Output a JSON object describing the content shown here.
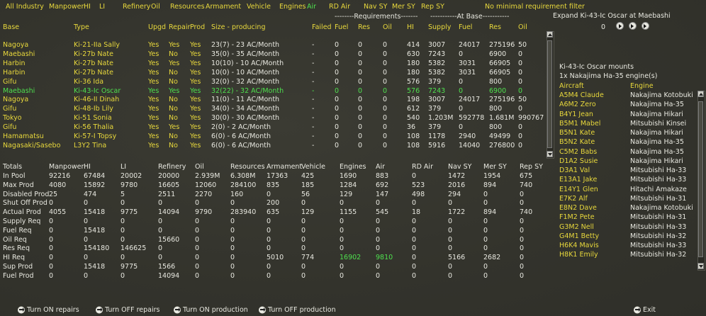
{
  "filters": [
    {
      "label": "All Industry",
      "active": false
    },
    {
      "label": "Manpower",
      "active": false
    },
    {
      "label": "HI",
      "active": false
    },
    {
      "label": "LI",
      "active": false
    },
    {
      "label": "Refinery",
      "active": false
    },
    {
      "label": "Oil",
      "active": false
    },
    {
      "label": "Resources",
      "active": false
    },
    {
      "label": "Armament",
      "active": false
    },
    {
      "label": "Vehicle",
      "active": false
    },
    {
      "label": "Engines",
      "active": false
    },
    {
      "label": "Air",
      "active": true
    },
    {
      "label": "RD Air",
      "active": false
    },
    {
      "label": "Nav SY",
      "active": false
    },
    {
      "label": "Mer SY",
      "active": false
    },
    {
      "label": "Rep SY",
      "active": false
    },
    {
      "label": "No minimal requirement filter",
      "active": false
    }
  ],
  "group_headers": {
    "requirements": "--------Requirements-------",
    "atbase": "-----------At Base-----------"
  },
  "columns": [
    "Base",
    "Type",
    "Upgd",
    "Repair",
    "Prod",
    "Size - producing",
    "Failed",
    "Fuel",
    "Res",
    "Oil",
    "HI",
    "Supply",
    "Fuel",
    "Res",
    "Oil"
  ],
  "factories": [
    {
      "base": "Nagoya",
      "type": "Ki-21-IIa Sally",
      "upgd": "Yes",
      "repair": "Yes",
      "prod": "Yes",
      "size": "23(7) - 23 AC/Month",
      "failed": "-",
      "fuel": "0",
      "res": "0",
      "oil": "0",
      "hi": "414",
      "supply": "3007",
      "bfuel": "24017",
      "bres": "275196",
      "boil": "50",
      "sel": false
    },
    {
      "base": "Maebashi",
      "type": "Ki-27b Nate",
      "upgd": "Yes",
      "repair": "No",
      "prod": "Yes",
      "size": "35(0) - 35 AC/Month",
      "failed": "-",
      "fuel": "0",
      "res": "0",
      "oil": "0",
      "hi": "630",
      "supply": "7243",
      "bfuel": "0",
      "bres": "6900",
      "boil": "0",
      "sel": false
    },
    {
      "base": "Harbin",
      "type": "Ki-27b Nate",
      "upgd": "Yes",
      "repair": "Yes",
      "prod": "Yes",
      "size": "10(10) - 10 AC/Month",
      "failed": "-",
      "fuel": "0",
      "res": "0",
      "oil": "0",
      "hi": "180",
      "supply": "5382",
      "bfuel": "3031",
      "bres": "66905",
      "boil": "0",
      "sel": false
    },
    {
      "base": "Harbin",
      "type": "Ki-27b Nate",
      "upgd": "Yes",
      "repair": "No",
      "prod": "Yes",
      "size": "10(0) - 10 AC/Month",
      "failed": "-",
      "fuel": "0",
      "res": "0",
      "oil": "0",
      "hi": "180",
      "supply": "5382",
      "bfuel": "3031",
      "bres": "66905",
      "boil": "0",
      "sel": false
    },
    {
      "base": "Gifu",
      "type": "Ki-36 Ida",
      "upgd": "Yes",
      "repair": "No",
      "prod": "Yes",
      "size": "32(0) - 32 AC/Month",
      "failed": "-",
      "fuel": "0",
      "res": "0",
      "oil": "0",
      "hi": "576",
      "supply": "379",
      "bfuel": "0",
      "bres": "800",
      "boil": "0",
      "sel": false
    },
    {
      "base": "Maebashi",
      "type": "Ki-43-Ic Oscar",
      "upgd": "Yes",
      "repair": "Yes",
      "prod": "Yes",
      "size": "32(22) - 32 AC/Month",
      "failed": "-",
      "fuel": "0",
      "res": "0",
      "oil": "0",
      "hi": "576",
      "supply": "7243",
      "bfuel": "0",
      "bres": "6900",
      "boil": "0",
      "sel": true
    },
    {
      "base": "Nagoya",
      "type": "Ki-46-II Dinah",
      "upgd": "Yes",
      "repair": "No",
      "prod": "Yes",
      "size": "11(0) - 11 AC/Month",
      "failed": "-",
      "fuel": "0",
      "res": "0",
      "oil": "0",
      "hi": "198",
      "supply": "3007",
      "bfuel": "24017",
      "bres": "275196",
      "boil": "50",
      "sel": false
    },
    {
      "base": "Gifu",
      "type": "Ki-48-Ib Lily",
      "upgd": "Yes",
      "repair": "No",
      "prod": "Yes",
      "size": "34(0) - 34 AC/Month",
      "failed": "-",
      "fuel": "0",
      "res": "0",
      "oil": "0",
      "hi": "612",
      "supply": "379",
      "bfuel": "0",
      "bres": "800",
      "boil": "0",
      "sel": false
    },
    {
      "base": "Tokyo",
      "type": "Ki-51 Sonia",
      "upgd": "Yes",
      "repair": "No",
      "prod": "Yes",
      "size": "30(0) - 30 AC/Month",
      "failed": "-",
      "fuel": "0",
      "res": "0",
      "oil": "0",
      "hi": "540",
      "supply": "1.203M",
      "bfuel": "592778",
      "bres": "1.681M",
      "boil": "990767",
      "sel": false
    },
    {
      "base": "Gifu",
      "type": "Ki-56 Thalia",
      "upgd": "Yes",
      "repair": "Yes",
      "prod": "Yes",
      "size": "2(0) - 2 AC/Month",
      "failed": "-",
      "fuel": "0",
      "res": "0",
      "oil": "0",
      "hi": "36",
      "supply": "379",
      "bfuel": "0",
      "bres": "800",
      "boil": "0",
      "sel": false
    },
    {
      "base": "Hamamatsu",
      "type": "Ki-57-I Topsy",
      "upgd": "Yes",
      "repair": "No",
      "prod": "Yes",
      "size": "6(0) - 6 AC/Month",
      "failed": "-",
      "fuel": "0",
      "res": "0",
      "oil": "0",
      "hi": "108",
      "supply": "1178",
      "bfuel": "2940",
      "bres": "49499",
      "boil": "0",
      "sel": false
    },
    {
      "base": "Nagasaki/Sasebo",
      "type": "L3Y2 Tina",
      "upgd": "Yes",
      "repair": "No",
      "prod": "Yes",
      "size": "6(0) - 6 AC/Month",
      "failed": "-",
      "fuel": "0",
      "res": "0",
      "oil": "0",
      "hi": "108",
      "supply": "5916",
      "bfuel": "14040",
      "bres": "276800",
      "boil": "0",
      "sel": false
    }
  ],
  "totals_headers": [
    "Totals",
    "Manpower",
    "HI",
    "LI",
    "Refinery",
    "Oil",
    "Resources",
    "Armament",
    "Vehicle",
    "Engines",
    "Air",
    "RD Air",
    "Nav SY",
    "Mer SY",
    "Rep SY"
  ],
  "totals": [
    {
      "label": "In Pool",
      "values": [
        "92216",
        "67484",
        "20002",
        "20000",
        "2.939M",
        "6.308M",
        "17363",
        "425",
        "1690",
        "883",
        "0",
        "1472",
        "1954",
        "675"
      ]
    },
    {
      "label": "Max Prod",
      "values": [
        "4080",
        "15892",
        "9780",
        "16605",
        "12060",
        "284100",
        "835",
        "185",
        "1284",
        "692",
        "523",
        "2016",
        "894",
        "740"
      ]
    },
    {
      "label": "Disabled Prod",
      "values": [
        "25",
        "474",
        "5",
        "2511",
        "2270",
        "160",
        "0",
        "56",
        "129",
        "147",
        "498",
        "294",
        "0",
        "0"
      ]
    },
    {
      "label": "Shut Off Prod",
      "values": [
        "0",
        "0",
        "0",
        "0",
        "0",
        "0",
        "200",
        "0",
        "0",
        "0",
        "0",
        "0",
        "0",
        "0"
      ]
    },
    {
      "label": "Actual Prod",
      "values": [
        "4055",
        "15418",
        "9775",
        "14094",
        "9790",
        "283940",
        "635",
        "129",
        "1155",
        "545",
        "18",
        "1722",
        "894",
        "740"
      ]
    },
    {
      "label": "Supply Req",
      "values": [
        "0",
        "0",
        "0",
        "0",
        "0",
        "0",
        "0",
        "0",
        "0",
        "0",
        "0",
        "0",
        "0",
        "0"
      ]
    },
    {
      "label": "Fuel Req",
      "values": [
        "0",
        "15418",
        "0",
        "0",
        "0",
        "0",
        "0",
        "0",
        "0",
        "0",
        "0",
        "0",
        "0",
        "0"
      ]
    },
    {
      "label": "Oil Req",
      "values": [
        "0",
        "0",
        "0",
        "15660",
        "0",
        "0",
        "0",
        "0",
        "0",
        "0",
        "0",
        "0",
        "0",
        "0"
      ]
    },
    {
      "label": "Res Req",
      "values": [
        "0",
        "154180",
        "146625",
        "0",
        "0",
        "0",
        "0",
        "0",
        "0",
        "0",
        "0",
        "0",
        "0",
        "0"
      ]
    },
    {
      "label": "HI Req",
      "values": [
        "0",
        "0",
        "0",
        "0",
        "0",
        "0",
        "5010",
        "774",
        "16902",
        "9810",
        "0",
        "5166",
        "2682",
        "0"
      ]
    },
    {
      "label": "Sup Prod",
      "values": [
        "0",
        "15418",
        "9775",
        "1566",
        "0",
        "0",
        "0",
        "0",
        "0",
        "0",
        "0",
        "0",
        "0",
        "0"
      ]
    },
    {
      "label": "Fuel Prod",
      "values": [
        "0",
        "0",
        "0",
        "14094",
        "0",
        "0",
        "0",
        "0",
        "0",
        "0",
        "0",
        "0",
        "0",
        "0"
      ]
    }
  ],
  "expand": {
    "title": "Expand Ki-43-Ic Oscar at Maebashi",
    "value": "0"
  },
  "mounts": {
    "title": "Ki-43-Ic Oscar mounts",
    "engine_line": "1x Nakajima Ha-35 engine(s)",
    "col_aircraft": "Aircraft",
    "col_engine": "Engine"
  },
  "mount_rows": [
    {
      "aircraft": "A5M4 Claude",
      "engine": "Nakajima Kotobuki"
    },
    {
      "aircraft": "A6M2 Zero",
      "engine": "Nakajima Ha-35"
    },
    {
      "aircraft": "B4Y1 Jean",
      "engine": "Nakajima Hikari"
    },
    {
      "aircraft": "B5M1 Mabel",
      "engine": "Mitsubishi Kinsei"
    },
    {
      "aircraft": "B5N1 Kate",
      "engine": "Nakajima Hikari"
    },
    {
      "aircraft": "B5N2 Kate",
      "engine": "Nakajima Ha-35"
    },
    {
      "aircraft": "C5M2 Babs",
      "engine": "Nakajima Ha-35"
    },
    {
      "aircraft": "D1A2 Susie",
      "engine": "Nakajima Hikari"
    },
    {
      "aircraft": "D3A1 Val",
      "engine": "Mitsubishi Ha-33"
    },
    {
      "aircraft": "E13A1 Jake",
      "engine": "Mitsubishi Ha-33"
    },
    {
      "aircraft": "E14Y1 Glen",
      "engine": "Hitachi Amakaze"
    },
    {
      "aircraft": "E7K2 Alf",
      "engine": "Mitsubishi Ha-31"
    },
    {
      "aircraft": "E8N2 Dave",
      "engine": "Nakajima Kotobuki"
    },
    {
      "aircraft": "F1M2 Pete",
      "engine": "Mitsubishi Ha-31"
    },
    {
      "aircraft": "G3M2 Nell",
      "engine": "Mitsubishi Ha-33"
    },
    {
      "aircraft": "G4M1 Betty",
      "engine": "Mitsubishi Ha-32"
    },
    {
      "aircraft": "H6K4 Mavis",
      "engine": "Mitsubishi Ha-33"
    },
    {
      "aircraft": "H8K1 Emily",
      "engine": "Mitsubishi Ha-32"
    }
  ],
  "actions": {
    "on_repairs": "Turn ON repairs",
    "off_repairs": "Turn OFF repairs",
    "on_production": "Turn ON production",
    "off_production": "Turn OFF production",
    "exit": "Exit"
  },
  "colors": {
    "yellow": "#e8d83c",
    "green": "#4ee04e",
    "white": "#e8e8e0",
    "background": "#35352e"
  }
}
